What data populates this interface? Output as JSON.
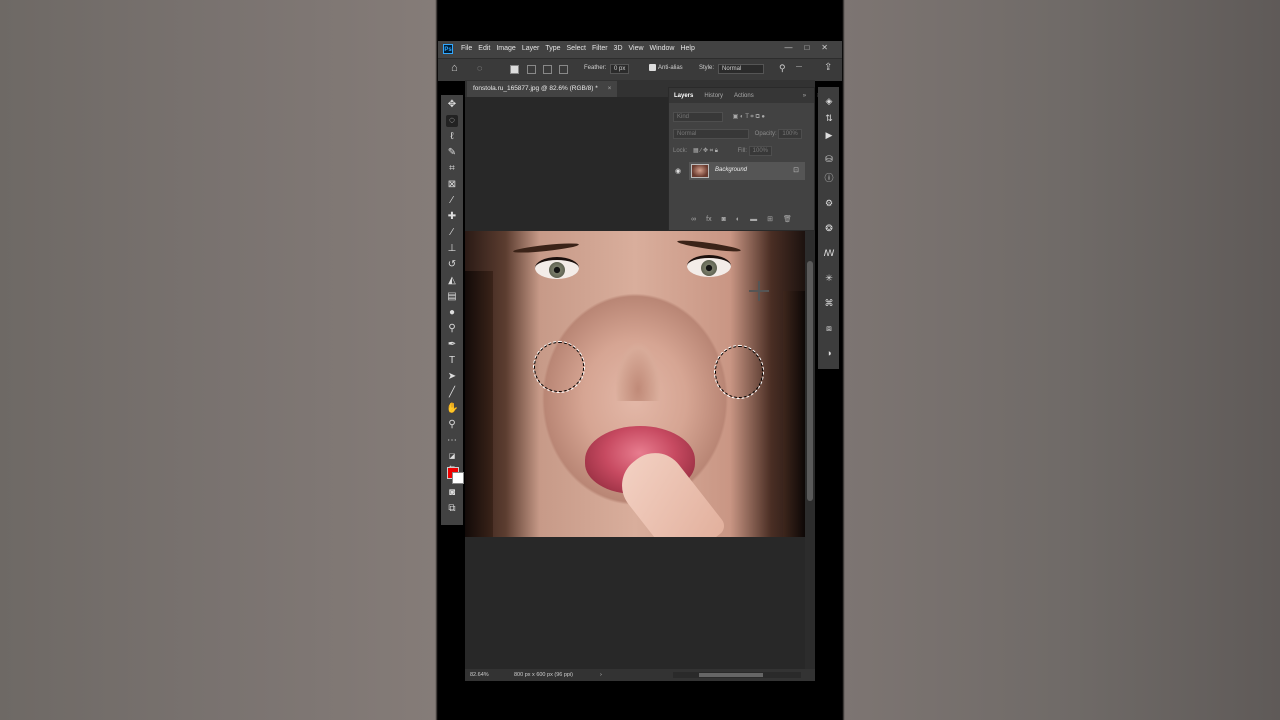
{
  "app": {
    "logo": "Ps",
    "menus": [
      "File",
      "Edit",
      "Image",
      "Layer",
      "Type",
      "Select",
      "Filter",
      "3D",
      "View",
      "Window",
      "Help"
    ],
    "window_buttons": [
      "—",
      "□",
      "✕"
    ]
  },
  "options_bar": {
    "feather_label": "Feather:",
    "feather_value": "0 px",
    "antialias_label": "Anti-alias",
    "style_label": "Style:",
    "style_value": "Normal",
    "width_dash": "—"
  },
  "document": {
    "tab_title": "fonstola.ru_165877.jpg @ 82.6% (RGB/8) *",
    "tab_close": "×"
  },
  "status_bar": {
    "zoom": "82.64%",
    "doc_info": "800 px x 600 px (96 ppi)",
    "arrow": "›"
  },
  "layers_panel": {
    "tabs": [
      "Layers",
      "History",
      "Actions"
    ],
    "collapse": "»",
    "kind_placeholder": "Kind",
    "blend_mode": "Normal",
    "opacity_label": "Opacity:",
    "opacity_value": "100%",
    "lock_label": "Lock:",
    "fill_label": "Fill:",
    "fill_value": "100%",
    "layer_name": "Background"
  },
  "colors": {
    "foreground": "#e00000",
    "background": "#ffffff",
    "accent": "#31a8ff"
  }
}
